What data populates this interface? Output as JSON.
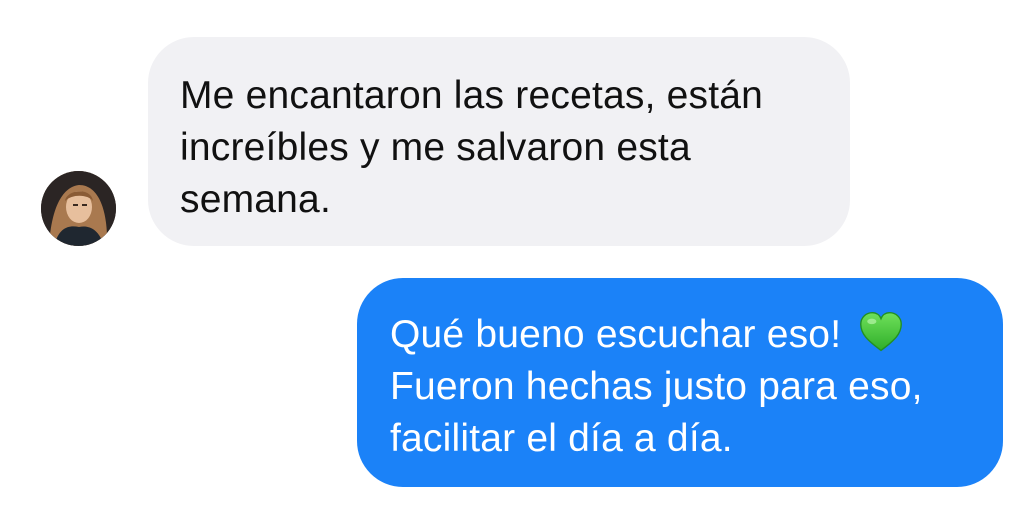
{
  "conversation": {
    "incoming": {
      "avatar_icon": "avatar",
      "lines": [
        "Me encantaron las recetas, están",
        "increíbles y me salvaron esta",
        "semana."
      ],
      "bubble_color": "#f1f1f4",
      "text_color": "#111111"
    },
    "outgoing": {
      "lines": [
        "Qué bueno escuchar eso!",
        "Fueron hechas justo para eso,",
        "facilitar el día a día."
      ],
      "emoji_icon": "green-heart-icon",
      "bubble_color": "#1b82f8",
      "text_color": "#ffffff"
    }
  }
}
